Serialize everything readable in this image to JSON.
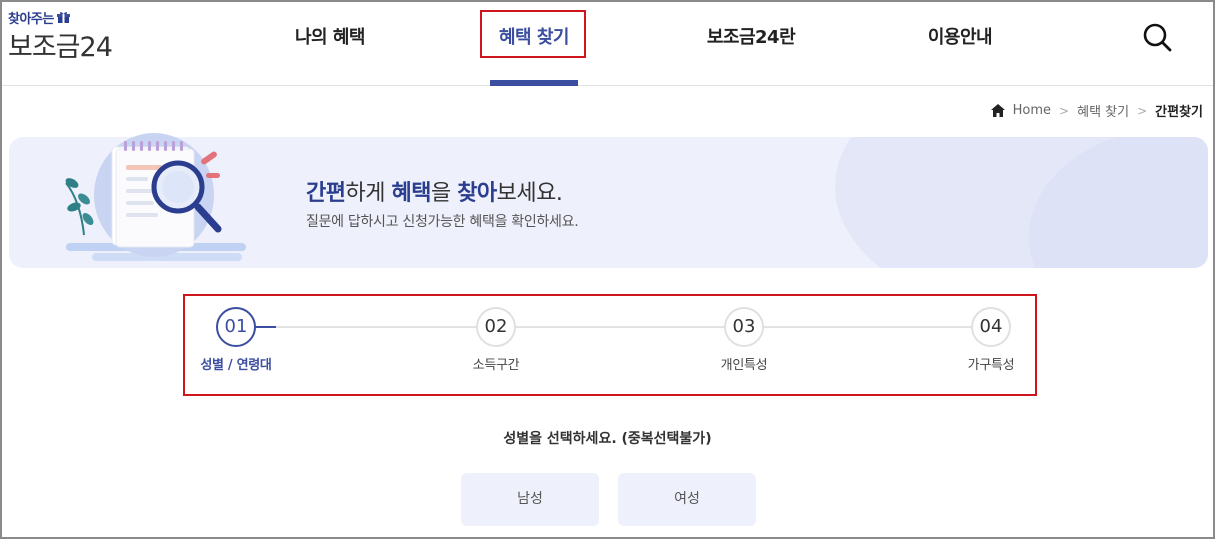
{
  "header": {
    "logo_top": "찾아주는",
    "logo_main": "보조금24",
    "nav": [
      "나의 혜택",
      "혜택 찾기",
      "보조금24란",
      "이용안내"
    ],
    "active_index": 1,
    "search_icon": "search-icon",
    "accent_color": "#3c4ea0"
  },
  "breadcrumb": {
    "home": "Home",
    "level1": "혜택 찾기",
    "current": "간편찾기"
  },
  "banner": {
    "title_parts": [
      "간편",
      "하게 ",
      "혜택",
      "을 ",
      "찾아",
      "보세요."
    ],
    "subtitle": "질문에 답하시고 신청가능한 혜택을 확인하세요."
  },
  "steps": [
    {
      "num": "01",
      "label": "성별 / 연령대",
      "active": true
    },
    {
      "num": "02",
      "label": "소득구간",
      "active": false
    },
    {
      "num": "03",
      "label": "개인특성",
      "active": false
    },
    {
      "num": "04",
      "label": "가구특성",
      "active": false
    }
  ],
  "question": "성별을 선택하세요. (중복선택불가)",
  "options": [
    "남성",
    "여성"
  ]
}
